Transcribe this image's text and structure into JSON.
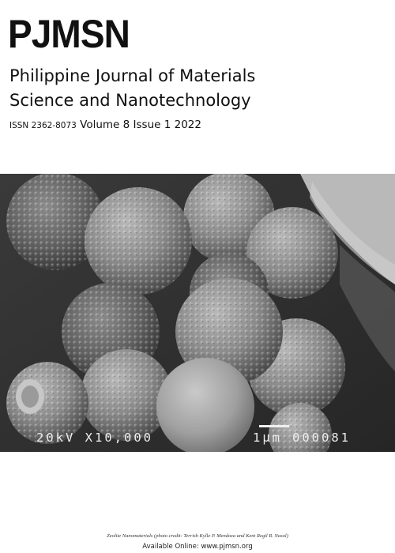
{
  "header": {
    "logo": "PJMSN",
    "title_line1": "Philippine Journal of Materials",
    "title_line2": "Science and Nanotechnology",
    "issn": "ISSN 2362-8073",
    "volume_issue_year": " Volume 8 Issue 1  2022"
  },
  "cover_image": {
    "description_subject": "Zeolite Nanomaterials",
    "hud_left": "20kV X10,000",
    "hud_scale_label": "1μm",
    "hud_id": "000081"
  },
  "footer": {
    "caption": "Zeolite Nanomaterials (photo credit: Terrish Kylle P. Mendoza and Kent Regil R. Nasol)",
    "available_online": "Available Online: www.pjmsn.org"
  },
  "colors": {
    "background": "#ffffff",
    "sem_background": "#2c2c2c",
    "text": "#111111"
  }
}
